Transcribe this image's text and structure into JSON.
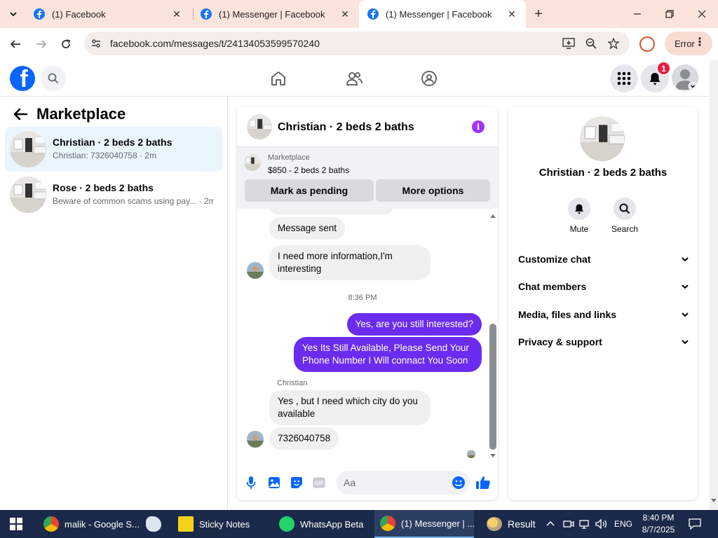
{
  "browser": {
    "tabs": [
      {
        "title": "(1) Facebook"
      },
      {
        "title": "(1) Messenger | Facebook"
      },
      {
        "title": "(1) Messenger | Facebook"
      }
    ],
    "active_tab": 2,
    "url": "facebook.com/messages/t/24134053599570240",
    "error_label": "Error"
  },
  "fb_nav": {
    "notification_count": "1"
  },
  "left_panel": {
    "title": "Marketplace",
    "conversations": [
      {
        "name": "Christian · 2 beds 2 baths",
        "snippet": "Christian: 7326040758 · 2m",
        "active": true
      },
      {
        "name": "Rose · 2 beds 2 baths",
        "snippet": "Beware of common scams using pay...  · 2m",
        "active": false
      }
    ]
  },
  "chat": {
    "title": "Christian · 2 beds 2 baths",
    "listing": {
      "source": "Marketplace",
      "price_line": "$850 - 2 beds 2 baths",
      "btn_pending": "Mark as pending",
      "btn_more": "More options"
    },
    "messages": {
      "m1": "Message sent",
      "m2": "I need more information,I'm interesting",
      "time": "8:36 PM",
      "m3": "Yes, are you still interested?",
      "m4": "Yes Its Still Available, Please Send Your Phone Number I Will connact You Soon",
      "sender": "Christian",
      "m5": "Yes , but I need which city do you available",
      "m6": "7326040758"
    },
    "composer_placeholder": "Aa",
    "accent_color": "#6b2cf0"
  },
  "right_panel": {
    "title": "Christian · 2 beds 2 baths",
    "actions": [
      {
        "label": "Mute",
        "icon": "bell-icon"
      },
      {
        "label": "Search",
        "icon": "search-icon"
      }
    ],
    "sections": [
      "Customize chat",
      "Chat members",
      "Media, files and links",
      "Privacy & support"
    ]
  },
  "taskbar": {
    "apps": [
      {
        "label": "malik - Google S..."
      },
      {
        "label": ""
      },
      {
        "label": "Sticky Notes"
      },
      {
        "label": "WhatsApp Beta"
      },
      {
        "label": "(1) Messenger | ..."
      }
    ],
    "weather_label": "Result",
    "language": "ENG",
    "time": "8:40 PM",
    "date": "8/7/2025"
  }
}
